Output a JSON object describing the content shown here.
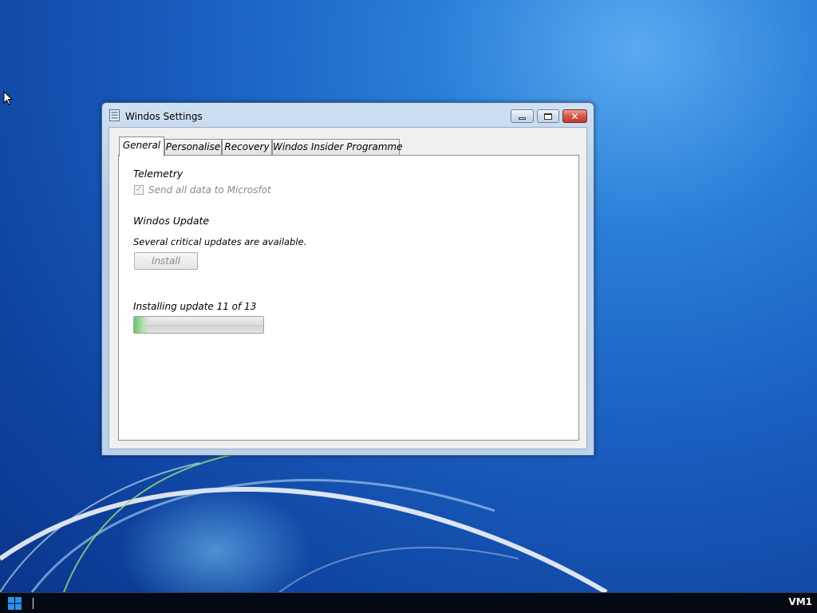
{
  "window": {
    "title": "Windos Settings",
    "close_glyph": "✕"
  },
  "tabs": [
    {
      "label": "General",
      "active": true
    },
    {
      "label": "Personalise",
      "active": false
    },
    {
      "label": "Recovery",
      "active": false
    },
    {
      "label": "Windos Insider Programme",
      "active": false
    }
  ],
  "telemetry": {
    "title": "Telemetry",
    "checkbox_label": "Send all data to Microsfot",
    "checked": true,
    "enabled": false,
    "check_glyph": "✓"
  },
  "update": {
    "title": "Windos Update",
    "message": "Several critical updates are available.",
    "install_label": "Install",
    "install_enabled": false,
    "progress_text": "Installing update 11 of 13",
    "progress_fraction": 0.12
  },
  "taskbar": {
    "vm_label": "VM1"
  },
  "icons": {
    "start": "windows-start-icon",
    "app": "settings-app-icon",
    "cursor": "mouse-cursor-icon"
  },
  "colors": {
    "desktop_blue": "#1a5fc0",
    "close_red": "#c23a2c",
    "progress_green": "#6cc46a",
    "taskbar": "#050a12"
  }
}
